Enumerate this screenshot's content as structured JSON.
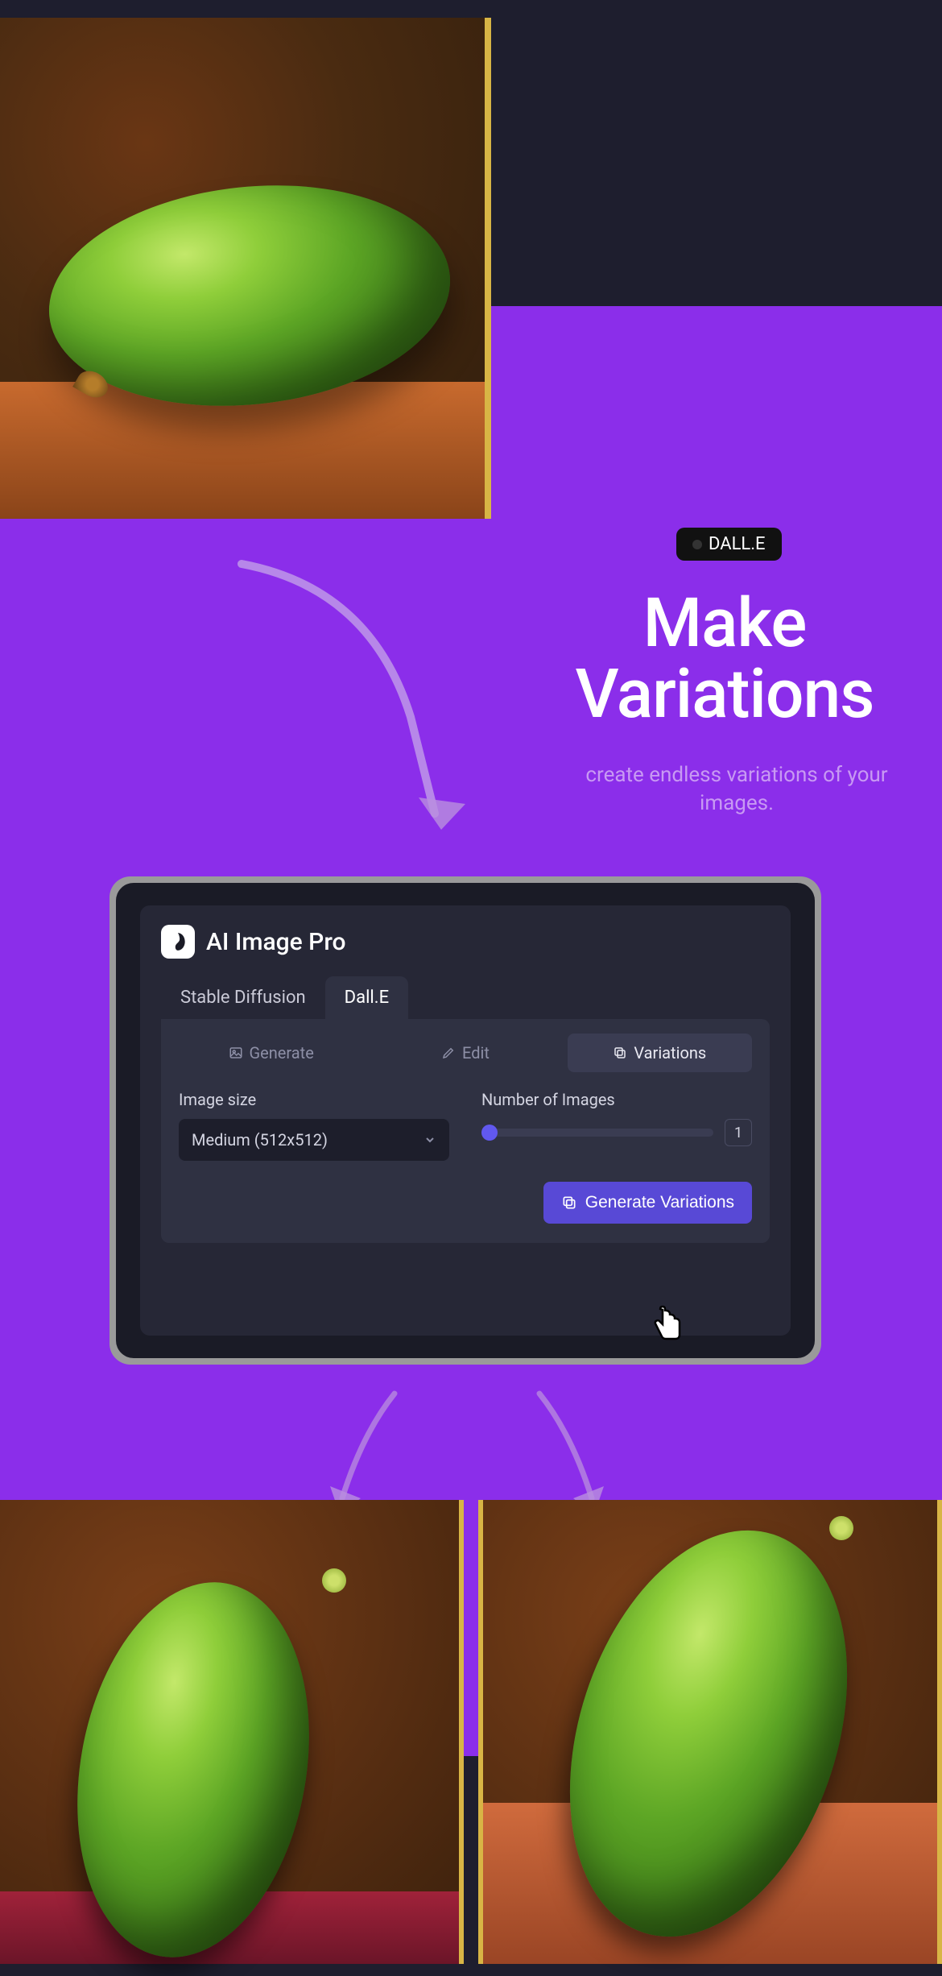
{
  "badge": {
    "label": "DALL.E"
  },
  "headline": {
    "line1": "Make",
    "line2": "Variations"
  },
  "subtitle": "create endless variations of your images.",
  "app": {
    "brand": "AI Image Pro",
    "tabs": [
      {
        "label": "Stable Diffusion",
        "active": false
      },
      {
        "label": "Dall.E",
        "active": true
      }
    ],
    "subtabs": [
      {
        "label": "Generate",
        "icon": "image-icon",
        "active": false
      },
      {
        "label": "Edit",
        "icon": "pencil-icon",
        "active": false
      },
      {
        "label": "Variations",
        "icon": "copy-icon",
        "active": true
      }
    ],
    "image_size": {
      "label": "Image size",
      "value": "Medium (512x512)"
    },
    "num_images": {
      "label": "Number of Images",
      "value": "1"
    },
    "action_button": "Generate Variations"
  }
}
